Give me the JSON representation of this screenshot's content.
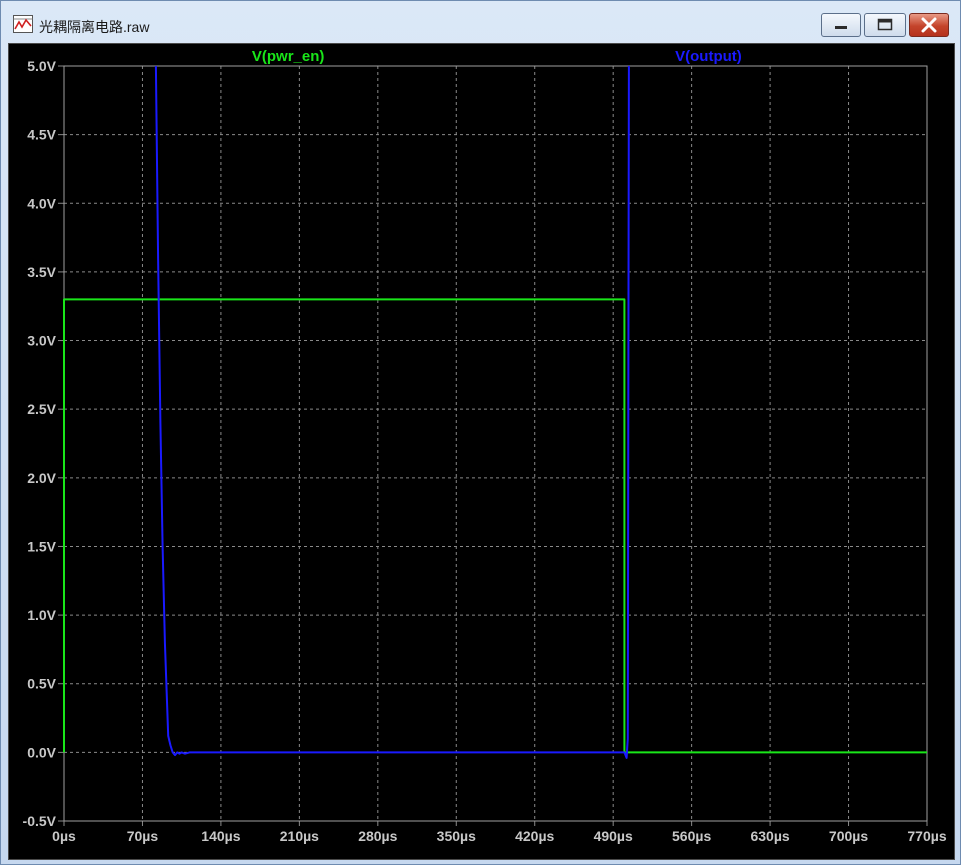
{
  "window": {
    "title": "光耦隔离电路.raw",
    "controls": {
      "minimize": "minimize",
      "maximize": "maximize",
      "close": "close"
    }
  },
  "colors": {
    "background": "#000000",
    "grid": "#8a8a8a",
    "axis_text": "#c8c8c8",
    "pwr_en": "#19e619",
    "output": "#1a1aff"
  },
  "chart_data": {
    "type": "line",
    "title": "",
    "xlabel": "",
    "ylabel": "",
    "x_unit": "µs",
    "y_unit": "V",
    "xlim": [
      0,
      770
    ],
    "ylim": [
      -0.5,
      5.0
    ],
    "grid": true,
    "x_ticks": [
      "0µs",
      "70µs",
      "140µs",
      "210µs",
      "280µs",
      "350µs",
      "420µs",
      "490µs",
      "560µs",
      "630µs",
      "700µs",
      "770µs"
    ],
    "y_ticks": [
      "5.0V",
      "4.5V",
      "4.0V",
      "3.5V",
      "3.0V",
      "2.5V",
      "2.0V",
      "1.5V",
      "1.0V",
      "0.5V",
      "0.0V",
      "-0.5V"
    ],
    "series": [
      {
        "name": "V(pwr_en)",
        "color": "#19e619",
        "x": [
          0,
          0,
          500,
          500,
          770
        ],
        "y": [
          0,
          3.3,
          3.3,
          0,
          0
        ]
      },
      {
        "name": "V(output)",
        "color": "#1a1aff",
        "x": [
          82,
          84,
          86,
          88,
          90,
          92,
          93,
          95,
          97,
          99,
          101,
          103,
          105,
          108,
          112,
          118,
          125,
          130,
          200,
          300,
          400,
          500,
          502,
          503,
          503.5,
          504
        ],
        "y": [
          5.0,
          3.6,
          2.4,
          1.5,
          0.8,
          0.35,
          0.12,
          0.05,
          0.0,
          -0.02,
          0.0,
          -0.01,
          0.0,
          -0.01,
          0.0,
          0.0,
          0.0,
          0.0,
          0.0,
          0.0,
          0.0,
          0.0,
          -0.04,
          0.1,
          2.5,
          5.0
        ]
      }
    ]
  }
}
